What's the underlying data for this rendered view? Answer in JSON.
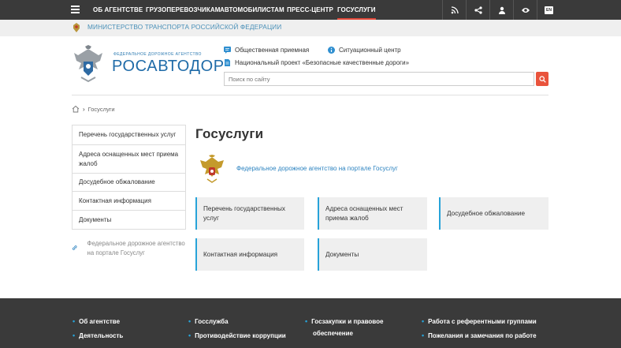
{
  "topnav": {
    "items": [
      "ОБ АГЕНТСТВЕ",
      "ГРУЗОПЕРЕВОЗЧИКАМ",
      "АВТОМОБИЛИСТАМ",
      "ПРЕСС-ЦЕНТР",
      "ГОСУСЛУГИ"
    ],
    "active": "ГОСУСЛУГИ",
    "tools": [
      "rss-icon",
      "share-icon",
      "user-icon",
      "eye-icon"
    ],
    "lang": "EN"
  },
  "ministry": {
    "text": "МИНИСТЕРСТВО ТРАНСПОРТА РОССИЙСКОЙ ФЕДЕРАЦИИ"
  },
  "header": {
    "logo_small": "ФЕДЕРАЛЬНОЕ ДОРОЖНОЕ АГЕНТСТВО",
    "logo_big": "РОСАВТОДОР",
    "links": [
      "Общественная приемная",
      "Ситуационный центр",
      "Национальный проект «Безопасные качественные дороги»"
    ],
    "search_placeholder": "Поиск по сайту"
  },
  "breadcrumb": {
    "current": "Госуслуги"
  },
  "sidebar": {
    "items": [
      "Перечень государственных услуг",
      "Адреса оснащенных мест приема жалоб",
      "Досудебное обжалование",
      "Контактная информация",
      "Документы"
    ],
    "link": "Федеральное дорожное агентство на портале Госуслуг"
  },
  "main": {
    "title": "Госуслуги",
    "portal_link": "Федеральное дорожное агентство на портале Госуслуг",
    "cards": [
      "Перечень государственных услуг",
      "Адреса оснащенных мест приема жалоб",
      "Досудебное обжалование",
      "Контактная информация",
      "Документы"
    ]
  },
  "footer": {
    "col1": [
      "Об агентстве",
      "Деятельность"
    ],
    "col2": [
      "Госслужба",
      "Противодействие коррупции"
    ],
    "col3": [
      "Госзакупки и правовое",
      "обеспечение"
    ],
    "col4": [
      "Работа с референтными группами",
      "Пожелания и замечания по работе"
    ]
  },
  "colors": {
    "accent": "#e2493a",
    "link": "#2c83c0",
    "card_border": "#27a3d9",
    "dark": "#3a3a3a"
  }
}
